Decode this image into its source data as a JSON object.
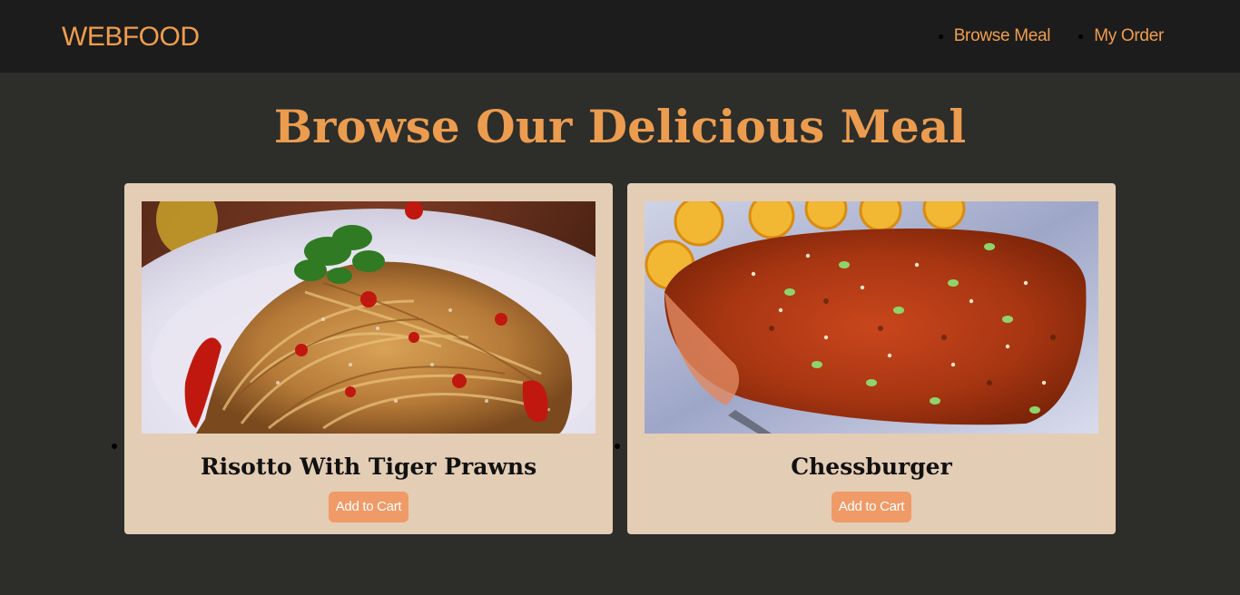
{
  "navbar": {
    "brand": "WEBFOOD",
    "links": [
      {
        "label": "Browse Meal"
      },
      {
        "label": "My Order"
      }
    ]
  },
  "main": {
    "title": "Browse Our Delicious Meal",
    "meals": [
      {
        "name": "Risotto With Tiger Prawns",
        "button_label": "Add to Cart",
        "image": "pasta-with-chili-photo"
      },
      {
        "name": "Chessburger",
        "button_label": "Add to Cart",
        "image": "glazed-salmon-photo"
      }
    ]
  },
  "colors": {
    "navbar_bg": "#1c1c1c",
    "page_bg": "#2d2d2a",
    "accent": "#ef9d4e",
    "card_bg": "#e4cdb5",
    "button_bg": "#ef9a67"
  }
}
